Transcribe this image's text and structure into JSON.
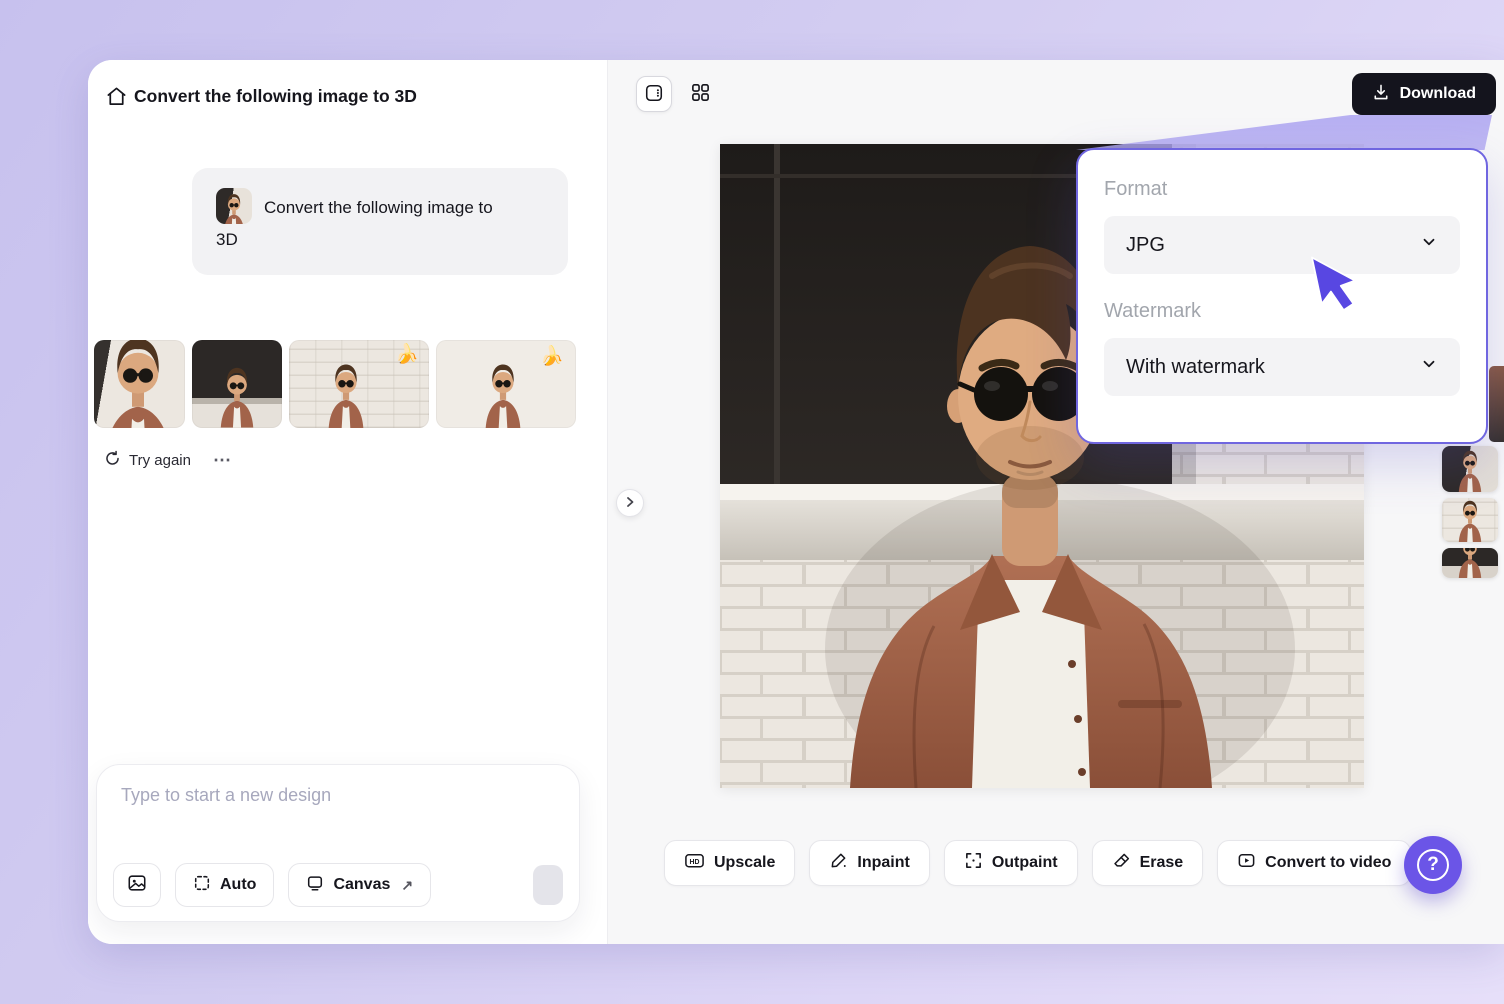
{
  "left_panel": {
    "title": "Convert the following image to 3D",
    "message": {
      "text": "Convert the following image to 3D"
    },
    "results": {
      "try_again": "Try again",
      "more": "⋯",
      "banana": "🍌"
    },
    "composer": {
      "placeholder": "Type to start a new design",
      "auto": "Auto",
      "canvas": "Canvas",
      "open_arrow": "↗"
    }
  },
  "canvas_panel": {
    "download": "Download",
    "hd_badge": "HD",
    "actions": [
      "Upscale",
      "Inpaint",
      "Outpaint",
      "Erase",
      "Convert to video"
    ],
    "help": "?"
  },
  "popup": {
    "format_label": "Format",
    "format_value": "JPG",
    "watermark_label": "Watermark",
    "watermark_value": "With watermark"
  },
  "colors": {
    "accent": "#6b55e7",
    "popup_border": "#7066e0",
    "download_bg": "#14141d",
    "canvas_bg": "#f7f7f8",
    "page_bg": "#cfc9f1",
    "cursor": "#5847e2"
  }
}
